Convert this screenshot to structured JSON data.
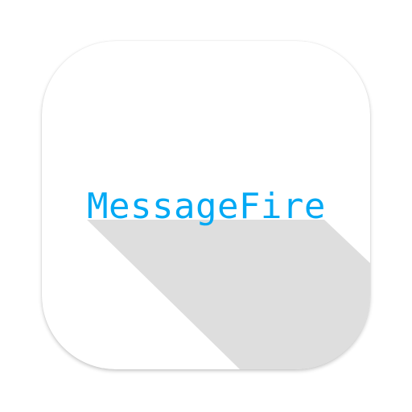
{
  "app_icon": {
    "label": "MessageFire",
    "label_color": "#03a9f4",
    "background_color": "#ffffff",
    "shadow_color": "#dedede"
  }
}
